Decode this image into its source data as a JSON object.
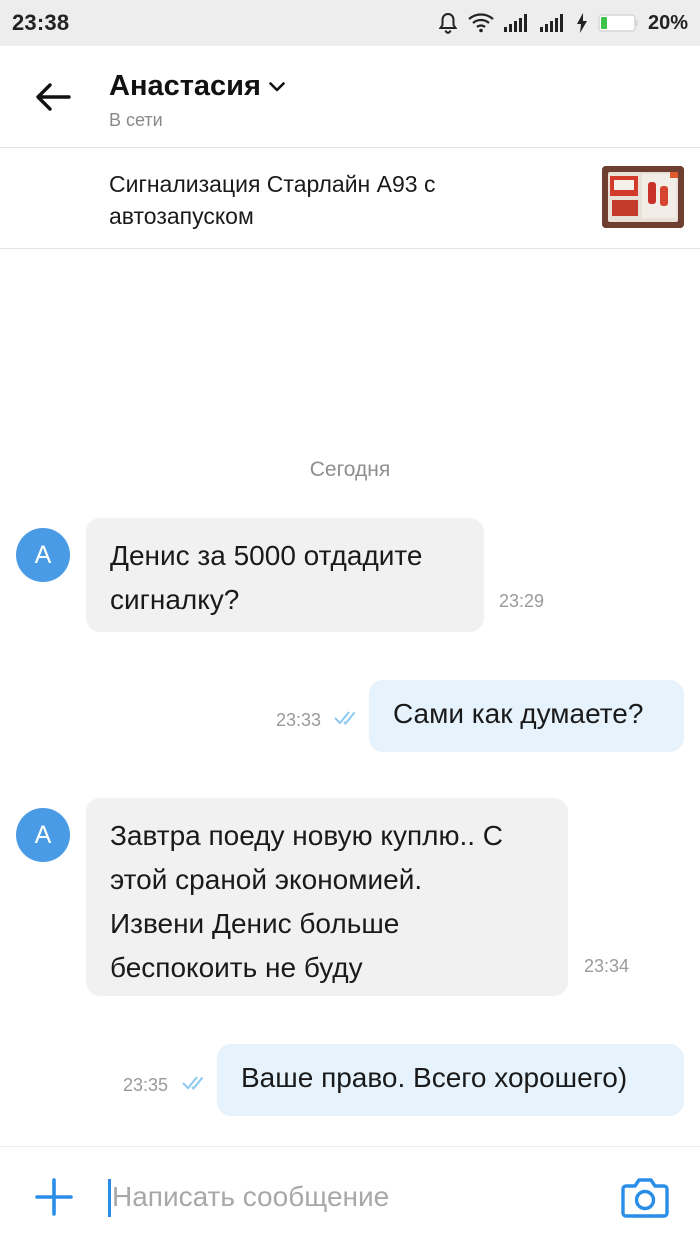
{
  "status_bar": {
    "time": "23:38",
    "battery": "20%",
    "icons": [
      "bell-icon",
      "wifi-icon",
      "signal-icon",
      "signal-icon",
      "charging-icon",
      "battery-icon"
    ]
  },
  "header": {
    "contact_name": "Анастасия",
    "contact_status": "В сети"
  },
  "product": {
    "title": "Сигнализация Старлайн А93 с автозапуском"
  },
  "chat": {
    "day_label": "Сегодня",
    "messages": [
      {
        "direction": "incoming",
        "avatar": "А",
        "text_lines": [
          "Денис за 5000 отдадите",
          "сигналку?"
        ],
        "time": "23:29"
      },
      {
        "direction": "outgoing",
        "text": "Сами как думаете?",
        "time": "23:33",
        "status": "read"
      },
      {
        "direction": "incoming",
        "avatar": "А",
        "text_lines": [
          "Завтра поеду новую куплю.. С",
          "этой сраной экономией.",
          "Извени Денис больше",
          "беспокоить не буду"
        ],
        "time": "23:34"
      },
      {
        "direction": "outgoing",
        "text": "Ваше право. Всего хорошего)",
        "time": "23:35",
        "status": "read"
      }
    ]
  },
  "composer": {
    "placeholder": "Написать сообщение"
  },
  "colors": {
    "accent": "#2a8ee8",
    "avatar_bg": "#4a9be6",
    "incoming_bubble": "#f1f1f1",
    "outgoing_bubble": "#e6f3fd",
    "status_bar_bg": "#ededed"
  }
}
